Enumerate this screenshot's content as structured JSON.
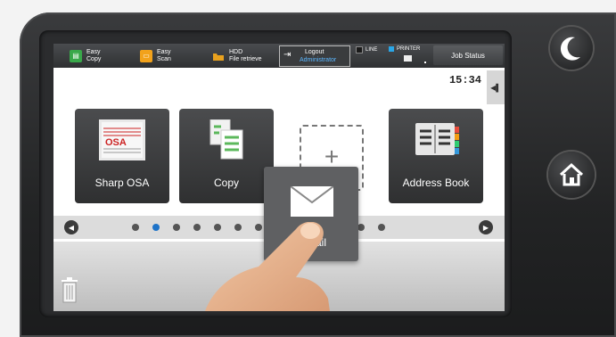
{
  "topbar": {
    "easy_copy": "Easy\nCopy",
    "easy_copy_l1": "Easy",
    "easy_copy_l2": "Copy",
    "easy_scan_l1": "Easy",
    "easy_scan_l2": "Scan",
    "hdd_l1": "HDD",
    "hdd_l2": "File retrieve",
    "logout_label": "Logout",
    "logout_user": "Administrator",
    "line_label": "LINE",
    "printer_label": "PRINTER",
    "job_status": "Job Status"
  },
  "clock": "15:34",
  "tiles": {
    "sharp_osa": "Sharp OSA",
    "copy": "Copy",
    "address_book": "Address Book",
    "email": "E-Mail"
  },
  "carousel": {
    "pages": 13,
    "active": 1
  },
  "colors": {
    "active_dot": "#1e73c8",
    "easy_copy": "#39a84a",
    "easy_scan": "#f2a21b",
    "hdd": "#e8a11e",
    "logout_user": "#5bb7ff",
    "line_indicator": "#1a1a1a",
    "printer_indicator": "#2aa6e6"
  },
  "icons": {
    "sleep": "moon-icon",
    "home": "home-icon",
    "trash": "trash-icon",
    "logout": "logout-icon",
    "email": "envelope-icon",
    "copy": "copy-icon",
    "address_book": "address-book-icon",
    "add": "plus-icon"
  }
}
